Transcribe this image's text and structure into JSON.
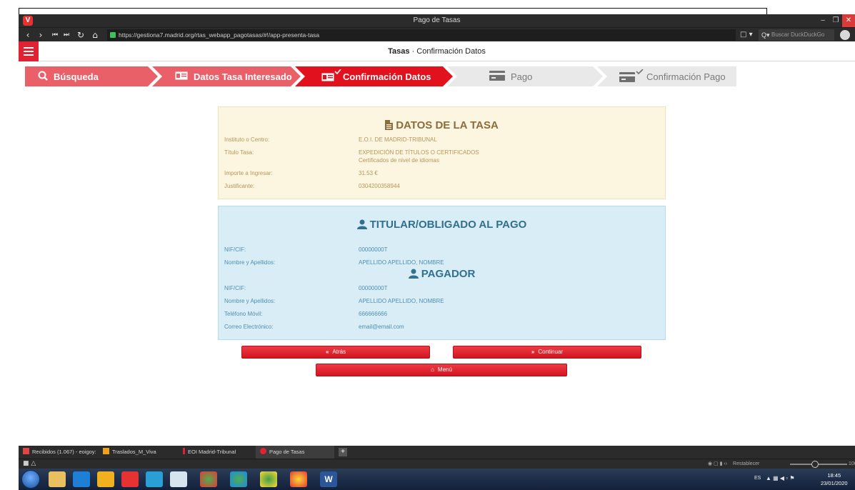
{
  "browser": {
    "window_title": "Pago de Tasas",
    "url": "https://gestiona7.madrid.org/rtas_webapp_pagotasas/#!/app-presenta-tasa",
    "search_placeholder": "Buscar DuckDuckGo"
  },
  "header": {
    "title_bold": "Tasas",
    "title_rest": " · Confirmación Datos"
  },
  "steps": [
    {
      "label": "Búsqueda",
      "icon": "search-icon"
    },
    {
      "label": "Datos Tasa Interesado",
      "icon": "id-card-icon"
    },
    {
      "label": "Confirmación Datos",
      "icon": "id-card-check-icon"
    },
    {
      "label": "Pago",
      "icon": "credit-card-icon"
    },
    {
      "label": "Confirmación Pago",
      "icon": "credit-card-check-icon"
    }
  ],
  "tasa": {
    "title": "DATOS DE LA TASA",
    "rows": [
      {
        "label": "Instituto o Centro:",
        "value": "E.O.I. DE MADRID-TRIBUNAL"
      },
      {
        "label": "Título Tasa:",
        "value": "EXPEDICIÓN DE TÍTULOS O CERTIFICADOS",
        "value2": "Certificados de nivel de idiomas"
      },
      {
        "label": "Importe a Ingresar:",
        "value": "31.53 €"
      },
      {
        "label": "Justificante:",
        "value": "0304200358944"
      }
    ]
  },
  "titular": {
    "title": "TITULAR/OBLIGADO AL PAGO",
    "rows": [
      {
        "label": "NIF/CIF:",
        "value": "00000000T"
      },
      {
        "label": "Nombre y Apellidos:",
        "value": "APELLIDO APELLIDO, NOMBRE"
      }
    ]
  },
  "pagador": {
    "title": "PAGADOR",
    "rows": [
      {
        "label": "NIF/CIF:",
        "value": "00000000T"
      },
      {
        "label": "Nombre y Apellidos:",
        "value": "APELLIDO APELLIDO, NOMBRE"
      },
      {
        "label": "Teléfono Móvil:",
        "value": "666666666"
      },
      {
        "label": "Correo Electrónico:",
        "value": "email@email.com"
      }
    ]
  },
  "buttons": {
    "back": "Atrás",
    "continue": "Continuar",
    "menu": "Menú"
  },
  "tabs": [
    {
      "label": "Recibidos (1.067) - eoigoy:"
    },
    {
      "label": "Traslados_M_Viva"
    },
    {
      "label": "EOI Madrid-Tribunal"
    },
    {
      "label": "Pago de Tasas"
    }
  ],
  "statusbar": {
    "zoom_label": "Restablecer",
    "zoom_value": "100"
  },
  "system": {
    "lang": "ES",
    "time": "18:45",
    "date": "23/01/2020"
  },
  "colors": {
    "brand_red": "#e02232",
    "step_active": "#e8505b",
    "step_inactive": "#e9e9e9",
    "tasa_bg": "#fcf5e0",
    "titular_bg": "#d9edf7"
  }
}
